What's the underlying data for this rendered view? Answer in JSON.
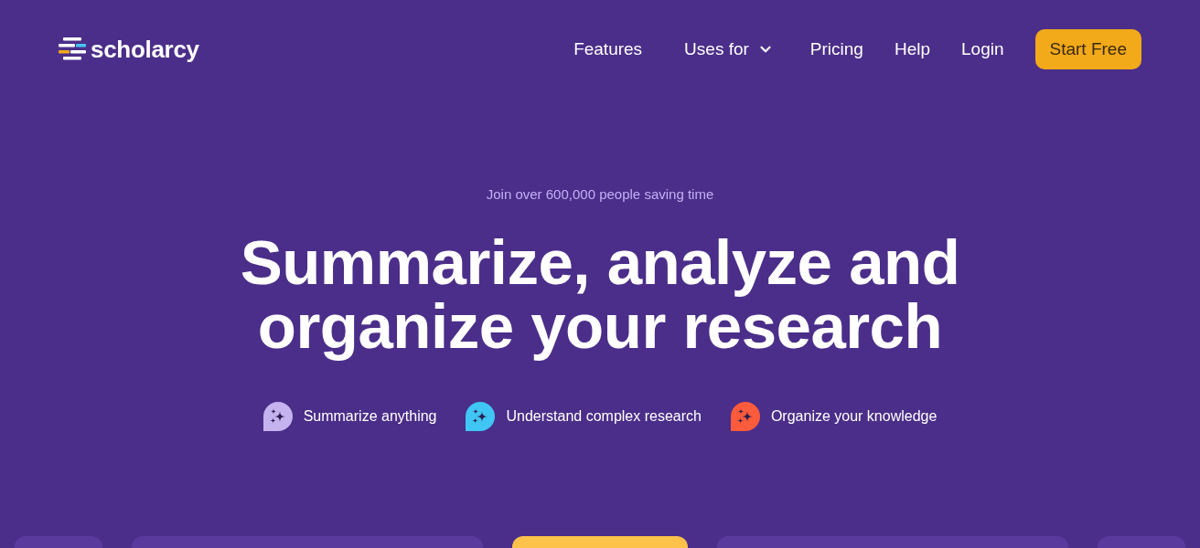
{
  "logo": {
    "text": "scholarcy"
  },
  "nav": {
    "items": [
      {
        "label": "Features",
        "kind": "link"
      },
      {
        "label": "Uses for",
        "kind": "dropdown"
      },
      {
        "label": "Pricing",
        "kind": "link"
      },
      {
        "label": "Help",
        "kind": "link"
      },
      {
        "label": "Login",
        "kind": "link"
      }
    ],
    "cta": "Start Free"
  },
  "hero": {
    "tagline": "Join over 600,000 people saving time",
    "headline": "Summarize, analyze and organize your research",
    "features": [
      {
        "label": "Summarize anything",
        "color": "#c5b3ef"
      },
      {
        "label": "Understand complex research",
        "color": "#40c6f4"
      },
      {
        "label": "Organize your knowledge",
        "color": "#fc5b3c"
      }
    ]
  },
  "cards": [
    {
      "color": "#5b3a9e"
    },
    {
      "color": "#5b3a9e"
    },
    {
      "color": "#fcc24a"
    },
    {
      "color": "#5b3a9e"
    },
    {
      "color": "#5b3a9e"
    }
  ]
}
